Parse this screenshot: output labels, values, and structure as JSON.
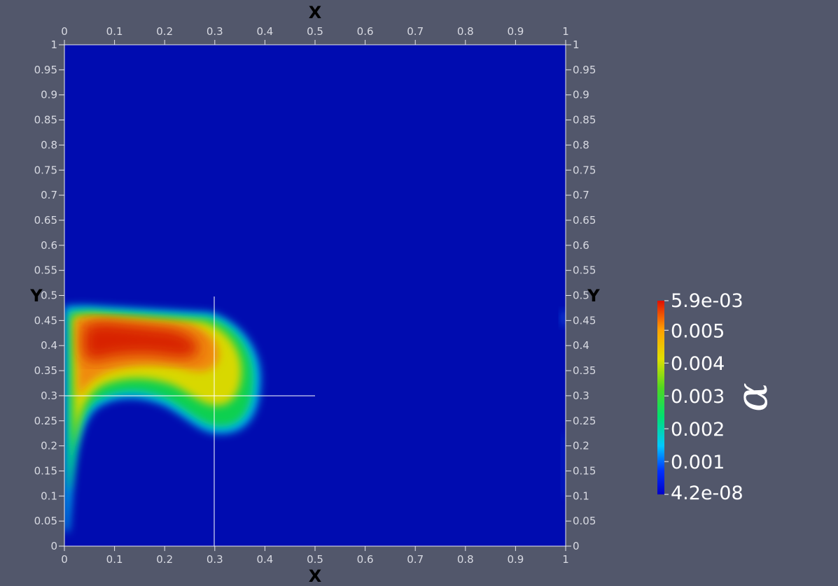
{
  "chart_data": {
    "type": "heatmap",
    "title": "",
    "xlabel": "X",
    "ylabel": "Y",
    "xlim": [
      0,
      1
    ],
    "ylim": [
      0,
      1
    ],
    "x_ticks": [
      "0",
      "0.1",
      "0.2",
      "0.3",
      "0.4",
      "0.5",
      "0.6",
      "0.7",
      "0.8",
      "0.9",
      "1"
    ],
    "y_ticks": [
      "0",
      "0.05",
      "0.1",
      "0.15",
      "0.2",
      "0.25",
      "0.3",
      "0.35",
      "0.4",
      "0.45",
      "0.5",
      "0.55",
      "0.6",
      "0.65",
      "0.7",
      "0.75",
      "0.8",
      "0.85",
      "0.9",
      "0.95",
      "1"
    ],
    "colormap": "jet",
    "colorbar": {
      "title": "α",
      "min": 4.2e-08,
      "max": 0.0059,
      "min_label": "4.2e-08",
      "max_label": "5.9e-03",
      "ticks": [
        "0.001",
        "0.002",
        "0.003",
        "0.004",
        "0.005"
      ],
      "tick_values": [
        0.001,
        0.002,
        0.003,
        0.004,
        0.005
      ],
      "colors": [
        "#0000b0",
        "#0010ff",
        "#00c8ff",
        "#00e060",
        "#40d020",
        "#d8e000",
        "#ffa000",
        "#e02000"
      ]
    },
    "background_color": "#000cb0",
    "field_description_values": {
      "peak_value": 0.0056,
      "peak_location": [
        0.12,
        0.42
      ]
    },
    "crosshair": {
      "x": 0.3,
      "y": 0.3
    }
  }
}
